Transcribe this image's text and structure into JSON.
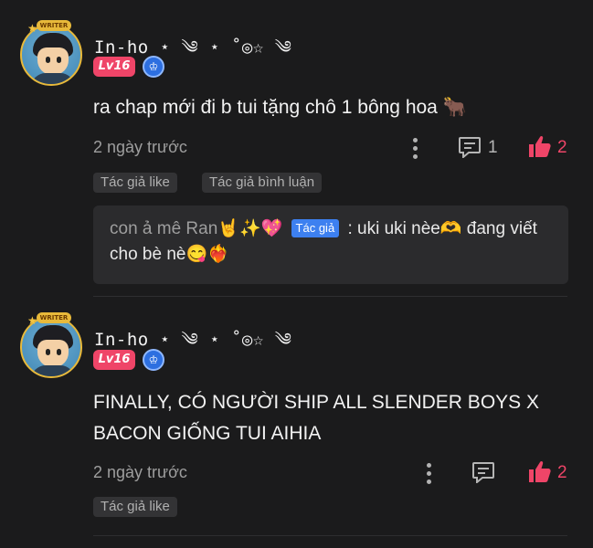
{
  "comments": [
    {
      "username": "In-ho ⋆ ༄ ⋆ ˚◎☆ ༄",
      "avatar_badge": "WRITER",
      "level": "Lv16",
      "text": "ra chap mới đi b tui tặng chô 1 bông hoa 🐂",
      "time": "2 ngày trước",
      "reply_count": "1",
      "like_count": "2",
      "tags": [
        "Tác giả like",
        "Tác giả bình luận"
      ],
      "reply": {
        "author": "con ả mê Ran🤘✨💖",
        "author_badge": "Tác giả",
        "text": ": uki uki nèe🫶 đang viết cho bè nè😋❤️‍🔥"
      }
    },
    {
      "username": "In-ho ⋆ ༄ ⋆ ˚◎☆ ༄",
      "avatar_badge": "WRITER",
      "level": "Lv16",
      "text": "FINALLY, CÓ NGƯỜI SHIP ALL SLENDER BOYS X BACON GIỐNG TUI AIHIA",
      "time": "2 ngày trước",
      "like_count": "2",
      "tags": [
        "Tác giả like"
      ]
    }
  ],
  "colors": {
    "accent": "#ef4568",
    "background": "#1b1b1c",
    "author_badge": "#3d80f0"
  },
  "icons": {
    "options": "more-vertical-icon",
    "reply": "comment-icon",
    "like": "thumbs-up-icon",
    "vip": "vip-badge-icon"
  }
}
